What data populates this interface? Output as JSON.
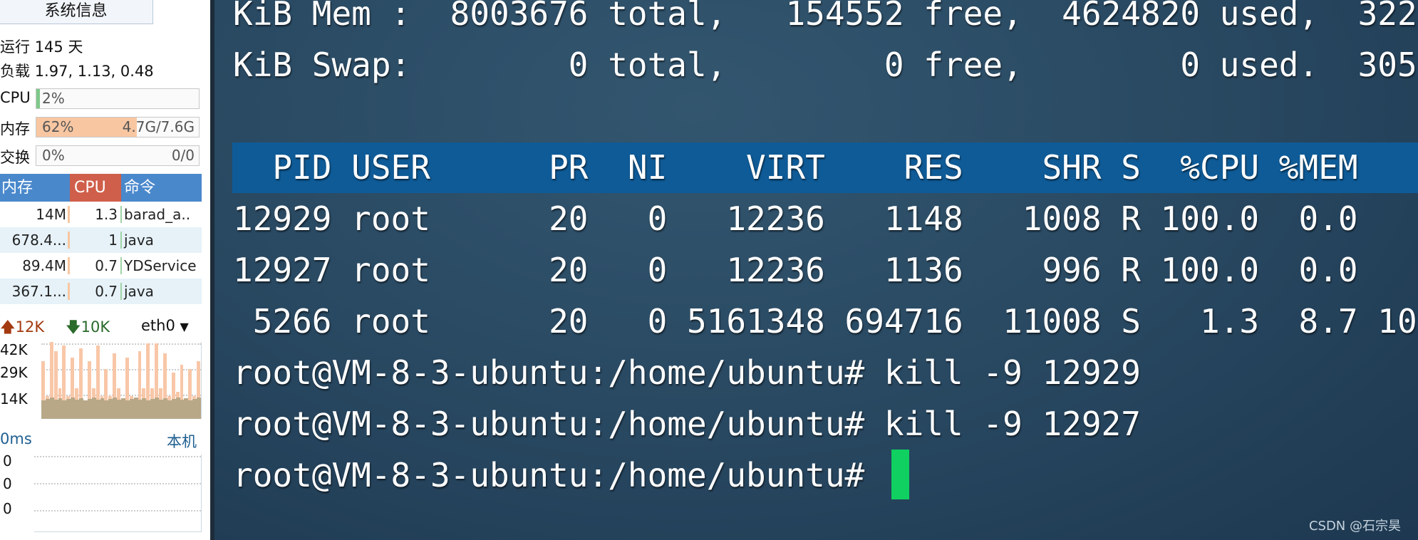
{
  "sidebar": {
    "title": "系统信息",
    "uptime_label": "运行",
    "uptime_value": "145 天",
    "load_label": "负载",
    "load_value": "1.97, 1.13, 0.48",
    "cpu": {
      "label": "CPU",
      "percent_text": "2%",
      "percent": 2,
      "color": "#7fc98a"
    },
    "mem": {
      "label": "内存",
      "percent_text": "62%",
      "usage": "4.7G/7.6G",
      "percent": 62,
      "color": "#f8c7a2"
    },
    "swap": {
      "label": "交换",
      "percent_text": "0%",
      "usage": "0/0",
      "percent": 0
    },
    "proc_table": {
      "headers": [
        "内存",
        "CPU",
        "命令"
      ],
      "rows": [
        [
          "14M",
          "1.3",
          "barad_a.."
        ],
        [
          "678.4...",
          "1",
          "java"
        ],
        [
          "89.4M",
          "0.7",
          "YDService"
        ],
        [
          "367.1...",
          "0.7",
          "java"
        ]
      ]
    },
    "network": {
      "upload": "12K",
      "download": "10K",
      "interface": "eth0",
      "y_labels": [
        "42K",
        "29K",
        "14K"
      ],
      "upload_color": "#f8c7a8",
      "download_color": "#b8a888"
    },
    "ping": {
      "latency": "0ms",
      "target": "本机",
      "y_labels": [
        "0",
        "0",
        "0"
      ]
    }
  },
  "terminal": {
    "lines": [
      "KiB Mem :  8003676 total,   154552 free,  4624820 used,  322",
      "KiB Swap:        0 total,        0 free,        0 used.  305",
      "",
      "  PID USER      PR  NI    VIRT    RES    SHR S  %CPU %MEM",
      "12929 root      20   0   12236   1148   1008 R 100.0  0.0",
      "12927 root      20   0   12236   1136    996 R 100.0  0.0",
      " 5266 root      20   0 5161348 694716  11008 S   1.3  8.7 10",
      "root@VM-8-3-ubuntu:/home/ubuntu# kill -9 12929",
      "root@VM-8-3-ubuntu:/home/ubuntu# kill -9 12927",
      "root@VM-8-3-ubuntu:/home/ubuntu# "
    ],
    "header_color": "#0f5b97",
    "cursor_color": "#0fd060"
  },
  "watermark": "CSDN @石宗昊"
}
